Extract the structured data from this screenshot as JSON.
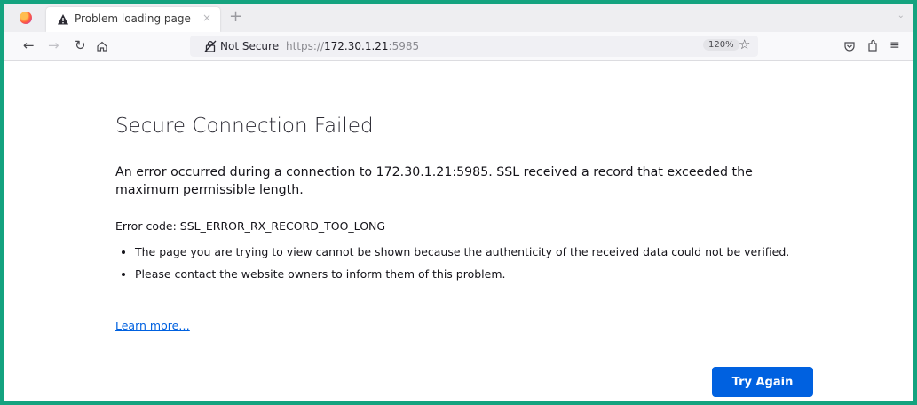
{
  "browser": {
    "tab_title": "Problem loading page",
    "tab_close": "×",
    "new_tab_symbol": "+",
    "not_secure_label": "Not Secure",
    "url_scheme": "https://",
    "url_host": "172.30.1.21",
    "url_port": ":5985",
    "zoom": "120%",
    "icons": [
      "firefox-logo",
      "warning-icon",
      "back-arrow-icon",
      "forward-arrow-icon",
      "reload-icon",
      "home-icon",
      "lock-icon",
      "bookmark-star-icon",
      "pocket-icon",
      "extensions-icon",
      "menu-icon"
    ]
  },
  "page": {
    "title": "Secure Connection Failed",
    "description": "An error occurred during a connection to 172.30.1.21:5985. SSL received a record that exceeded the maximum permissible length.",
    "error_code": "Error code: SSL_ERROR_RX_RECORD_TOO_LONG",
    "bullets": [
      "The page you are trying to view cannot be shown because the authenticity of the received data could not be verified.",
      "Please contact the website owners to inform them of this problem."
    ],
    "learn_more": "Learn more…",
    "try_again": "Try Again"
  },
  "colors": {
    "frame_border": "#14a37f",
    "button_primary": "#0061e0",
    "link": "#0061e0"
  }
}
